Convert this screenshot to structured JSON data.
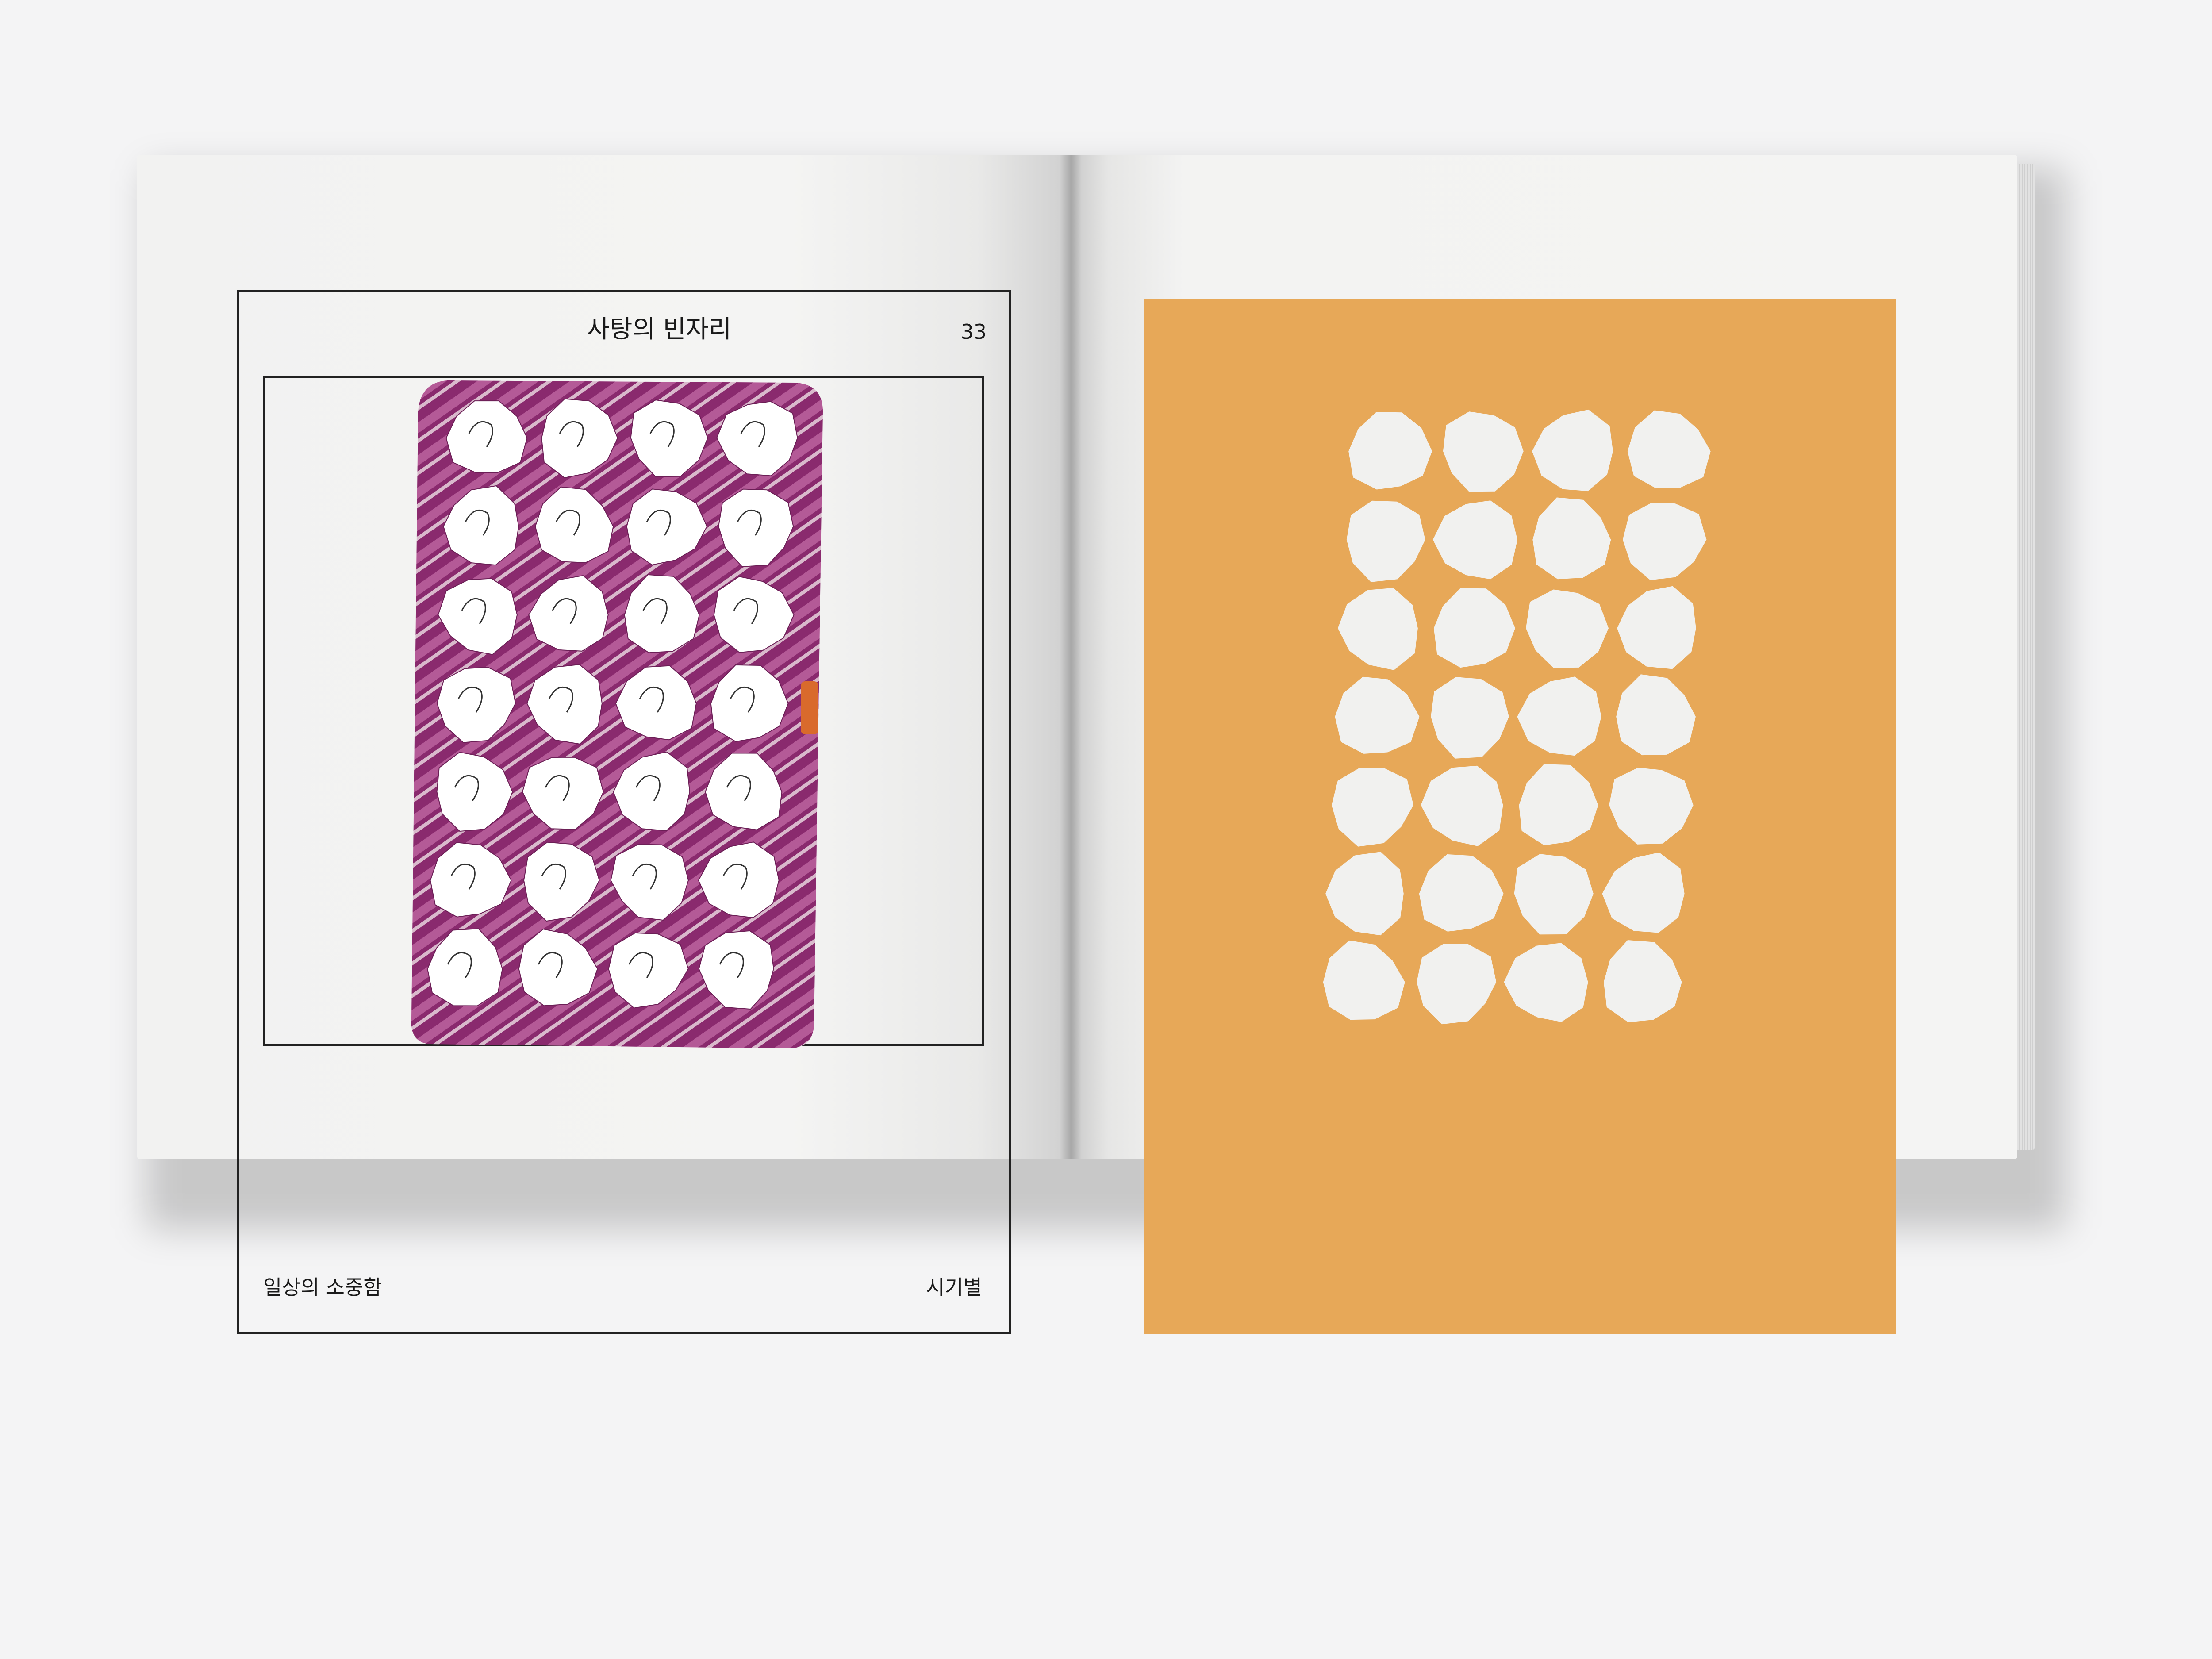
{
  "left_page": {
    "title": "사탕의 빈자리",
    "page_number": "33",
    "footer_left": "일상의 소중함",
    "footer_right": "시기별"
  },
  "illustration": {
    "blister_color": "#8a2a6e",
    "dot_color": "#f1f1ef",
    "panel_color": "#e7a858",
    "rows": 7,
    "cols": 4
  }
}
